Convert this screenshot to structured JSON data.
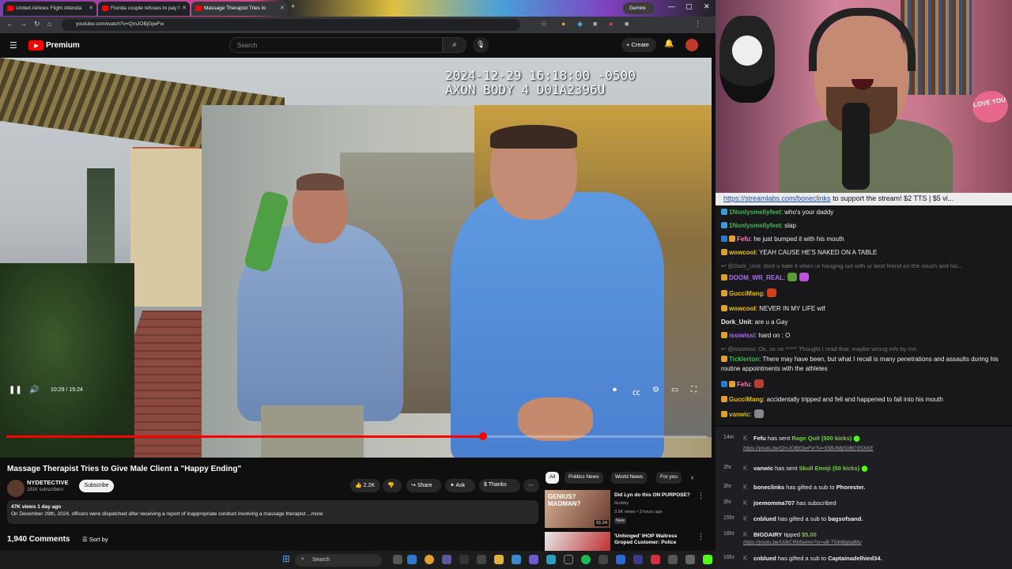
{
  "browser": {
    "tabs": [
      {
        "title": "United Airlines Flight Attenda"
      },
      {
        "title": "Florida couple refuses to pay f"
      },
      {
        "title": "Massage Therapist Tries to"
      }
    ],
    "gemini_label": "Gemini",
    "url": "youtube.com/watch?v=QmJOBjGjwFw"
  },
  "youtube": {
    "brand": "Premium",
    "search_placeholder": "Search",
    "create_label": "Create",
    "video": {
      "overlay_line1": "2024-12-29 16:18:00 -0500",
      "overlay_line2": "AXON BODY 4 D01A2396U",
      "time": "10:29 / 15:24",
      "progress_fraction": 0.681,
      "title": "Massage Therapist Tries to Give Male Client a \"Happy Ending\"",
      "channel": "NYDETECTIVE",
      "subscribers": "181K subscribers",
      "subscribe_label": "Subscribe",
      "likes": "2.2K",
      "share_label": "Share",
      "ask_label": "Ask",
      "thanks_label": "Thanks",
      "views_meta": "47K views  1 day ago",
      "description": "On December 29th, 2024, officers were dispatched after receiving a report of inappropriate conduct involving a massage therapist ...more",
      "comments_count": "1,940 Comments",
      "sort_label": "Sort by"
    },
    "chips": [
      "All",
      "Politics News",
      "World News",
      "For you"
    ],
    "suggestions": [
      {
        "title": "Did Lyn do this ON PURPOSE?",
        "channel": "Grubby",
        "meta": "3.5K views • 3 hours ago",
        "badge": "New",
        "duration": "51:24",
        "thumb_text": "GENIUS? MADMAN?"
      },
      {
        "title": "'Unhinged' IHOP Waitress Groped Customer: Police"
      }
    ]
  },
  "taskbar": {
    "search_placeholder": "Search"
  },
  "stream": {
    "love_sign": "LOVE YOU",
    "banner_link": "https://streamlabs.com/boneclinks",
    "banner_text": " to support the stream! $2 TTS | $5 vi..."
  },
  "chat": [
    {
      "user": "1Nonlysmellyfeet",
      "text": ": who's your daddy",
      "color": "#3fb950"
    },
    {
      "user": "1Nonlysmellyfeet",
      "text": ": slap",
      "color": "#3fb950"
    },
    {
      "user": "Fefu",
      "text": ": he just bumped it with his mouth",
      "color": "#ff7eb6"
    },
    {
      "user": "wowcool",
      "text": ": YEAH CAUSE HE'S NAKED ON A TABLE",
      "color": "#e5c100"
    },
    {
      "user": "@Dork_Unit",
      "text": ": dont u hate it when ur hanging out with ur best friend on the couch and his...",
      "color": "#777"
    },
    {
      "user": "DOOM_WR_REAL",
      "text": ":",
      "color": "#b06cf0"
    },
    {
      "user": "GucciMang",
      "text": ":",
      "color": "#e5c100"
    },
    {
      "user": "wowcool",
      "text": ": NEVER IN MY LIFE wtf",
      "color": "#e5c100"
    },
    {
      "user": "Dork_Unit",
      "text": ": are u a Gay",
      "color": "#efeff1"
    },
    {
      "user": "issiwissi",
      "text": ": hard on : O",
      "color": "#b06cf0"
    },
    {
      "user": "@issiwissi",
      "text": ": Ok, so no ***** Thought I read that, maybe wrong info by me.",
      "color": "#777"
    },
    {
      "user": "Ticklerton",
      "text": ": There may have been, but what I recall is many penetrations and assaults during his routine appointments with the athletes",
      "color": "#3fb950"
    },
    {
      "user": "Fefu",
      "text": ":",
      "color": "#ff7eb6"
    },
    {
      "user": "GucciMang",
      "text": ": accidentally tripped and fell and happened to fall into his mouth",
      "color": "#e5c100"
    },
    {
      "user": "vanwic",
      "text": ":",
      "color": "#e5c100"
    }
  ],
  "activity": [
    {
      "time": "14m",
      "user": "Fefu",
      "action": " has sent ",
      "item": "Rage Quit (500 kicks)",
      "link": "https://youtu.be/QmJOBjGjwFw?si=55BJ68jS0BO3SXKE"
    },
    {
      "time": "2hr",
      "user": "vanwic",
      "action": " has sent ",
      "item": "Skull Emoji (50 kicks)"
    },
    {
      "time": "3hr",
      "user": "boneclinks",
      "action": " has gifted a sub to ",
      "target": "Phorester."
    },
    {
      "time": "3hr",
      "user": "joemomma707",
      "action": " has subscribed"
    },
    {
      "time": "15hr",
      "user": "cnblued",
      "action": " has gifted a sub to ",
      "target": "bagsofsand."
    },
    {
      "time": "16hr",
      "user": "BIGDAIRY",
      "action": " tipped ",
      "item": "$5.00",
      "link": "https://youtu.be/U0kCRbSyimo?si=yB-TGkt6jqIgBliu"
    },
    {
      "time": "16hr",
      "user": "cnblued",
      "action": " has gifted a sub to ",
      "target": "Captainadelhied34."
    }
  ],
  "colors": {
    "yt_red": "#ff0000",
    "chat_bg": "#18181b",
    "activity_green": "#7ac943"
  }
}
